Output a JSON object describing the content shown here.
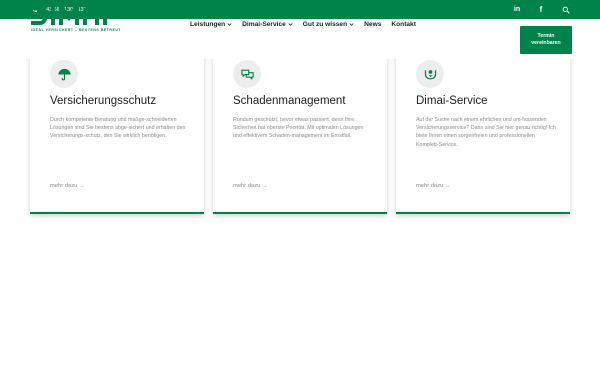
{
  "topbar": {
    "phone": "+43 660 130 3137",
    "social": [
      "linkedin-icon",
      "facebook-icon",
      "search-icon"
    ],
    "linkedin_glyph": "in",
    "facebook_glyph": "f"
  },
  "logo": {
    "tagline": "IDEAL VERSICHERT – BESTENS BETREUT"
  },
  "nav": {
    "items": [
      {
        "label": "Leistungen",
        "has_dropdown": true
      },
      {
        "label": "Dimai-Service",
        "has_dropdown": true
      },
      {
        "label": "Gut zu wissen",
        "has_dropdown": true
      },
      {
        "label": "News",
        "has_dropdown": false
      },
      {
        "label": "Kontakt",
        "has_dropdown": false
      }
    ],
    "cta_line1": "Termin",
    "cta_line2": "vereinbaren"
  },
  "cards": [
    {
      "icon": "umbrella-icon",
      "title": "Versicherungsschutz",
      "text": "Durch kompetente Beratung und maßge-schneiderten Lösungen sind Sie bestens abge-sichert und erhalten den Versicherungs-schutz, den Sie wirklich benötigen.",
      "link": "mehr dazu →"
    },
    {
      "icon": "chat-bubbles-icon",
      "title": "Schadenmanagement",
      "text": "Rundum geschützt, bevor etwas passiert, denn Ihre Sicherheit hat oberste Priorität. Mit optimalen Lösungen und effektivem Schaden-management im Ernstfall.",
      "link": "mehr dazu →"
    },
    {
      "icon": "hands-person-icon",
      "title": "Dimai-Service",
      "text": "Auf der Suche nach einem ehrlichen und um-fassenden Versicherungsservice? Dann sind Sie hier genau richtig! Ich biete Ihnen einen sorgenfreien und professionellen Komplett-Service.",
      "link": "mehr dazu →"
    }
  ],
  "colors": {
    "brand_green": "#00834b",
    "text_dark": "#222222",
    "text_muted": "#8a8a8a",
    "icon_bg": "#ededed"
  }
}
